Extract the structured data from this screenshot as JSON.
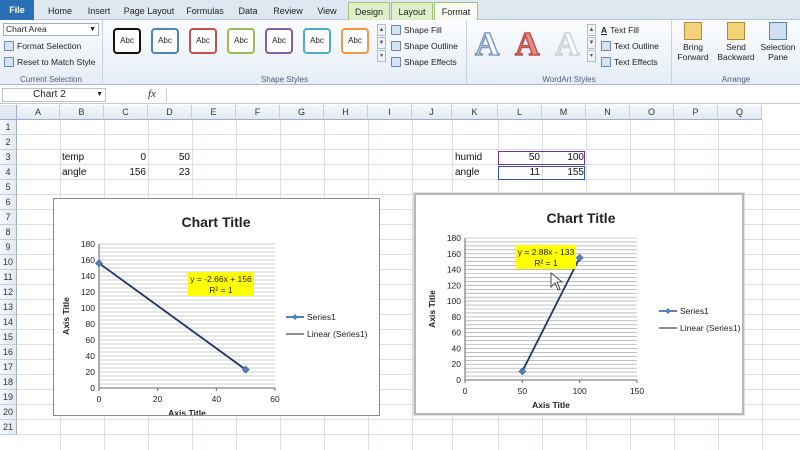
{
  "tabs": {
    "file": "File",
    "home": "Home",
    "insert": "Insert",
    "page_layout": "Page Layout",
    "formulas": "Formulas",
    "data": "Data",
    "review": "Review",
    "view": "View",
    "design": "Design",
    "layout": "Layout",
    "format": "Format"
  },
  "ribbon": {
    "current_selection": {
      "dropdown": "Chart Area",
      "format_selection": "Format Selection",
      "reset": "Reset to Match Style",
      "label": "Current Selection"
    },
    "shape_styles": {
      "sample": "Abc",
      "fill": "Shape Fill",
      "outline": "Shape Outline",
      "effects": "Shape Effects",
      "label": "Shape Styles"
    },
    "wordart": {
      "letter": "A",
      "text_fill": "Text Fill",
      "text_outline": "Text Outline",
      "text_effects": "Text Effects",
      "label": "WordArt Styles"
    },
    "arrange": {
      "bring1": "Bring",
      "bring2": "Forward",
      "send1": "Send",
      "send2": "Backward",
      "sel1": "Selection",
      "sel2": "Pane",
      "label": "Arrange"
    }
  },
  "formula_bar": {
    "name_box": "Chart 2",
    "fx": "fx"
  },
  "sheet": {
    "columns": [
      "A",
      "B",
      "C",
      "D",
      "E",
      "F",
      "G",
      "H",
      "I",
      "J",
      "K",
      "L",
      "M",
      "N",
      "O",
      "P",
      "Q"
    ],
    "rows": [
      "1",
      "2",
      "3",
      "4",
      "5",
      "6",
      "7",
      "8",
      "9",
      "10",
      "11",
      "12",
      "13",
      "14",
      "15",
      "16",
      "17",
      "18",
      "19",
      "20",
      "21"
    ],
    "cells": {
      "b3": "temp",
      "c3": "0",
      "d3": "50",
      "b4": "angle",
      "c4": "156",
      "d4": "23",
      "k3": "humid",
      "l3": "50",
      "m3": "100",
      "k4": "angle",
      "l4": "11",
      "m4": "155"
    }
  },
  "chart_data": [
    {
      "type": "scatter",
      "title": "Chart Title",
      "xlabel": "Axis Title",
      "ylabel": "Axis Title",
      "xlim": [
        0,
        60
      ],
      "ylim": [
        0,
        180
      ],
      "xticks": [
        "0",
        "20",
        "40",
        "60"
      ],
      "yticks": [
        "0",
        "20",
        "40",
        "60",
        "80",
        "100",
        "120",
        "140",
        "160",
        "180"
      ],
      "series": [
        {
          "name": "Series1",
          "x": [
            0,
            50
          ],
          "y": [
            156,
            23
          ]
        }
      ],
      "trendline": {
        "name": "Linear (Series1)",
        "equation": "y = -2.66x + 156",
        "r2": "R² = 1"
      },
      "legend": "right",
      "grid": true,
      "colors": {
        "series": "#1f3864",
        "label_bg": "#ffff00"
      }
    },
    {
      "type": "scatter",
      "title": "Chart Title",
      "xlabel": "Axis Title",
      "ylabel": "Axis Title",
      "xlim": [
        0,
        150
      ],
      "ylim": [
        0,
        180
      ],
      "xticks": [
        "0",
        "50",
        "100",
        "150"
      ],
      "yticks": [
        "0",
        "20",
        "40",
        "60",
        "80",
        "100",
        "120",
        "140",
        "160",
        "180"
      ],
      "series": [
        {
          "name": "Series1",
          "x": [
            50,
            100
          ],
          "y": [
            11,
            155
          ]
        }
      ],
      "trendline": {
        "name": "Linear (Series1)",
        "equation": "y = 2.88x - 133",
        "r2": "R² = 1"
      },
      "legend": "right",
      "grid": true,
      "colors": {
        "series": "#1f3864",
        "label_bg": "#ffff00"
      }
    }
  ]
}
